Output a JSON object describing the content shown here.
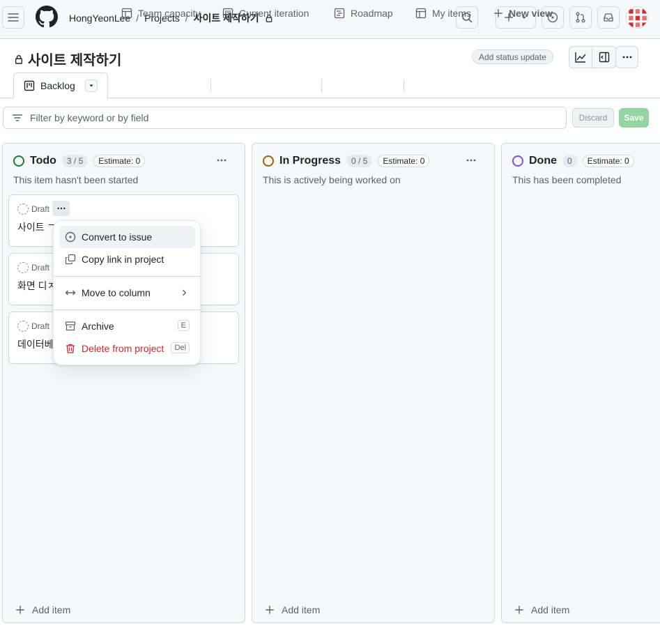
{
  "header": {
    "owner": "HongYeonLee",
    "projects_link": "Projects",
    "current_project": "사이트 제작하기",
    "separator": "/"
  },
  "project": {
    "title": "사이트 제작하기",
    "status_update": "Add status update"
  },
  "tabs": [
    {
      "label": "Backlog",
      "icon": "board-icon",
      "active": true
    },
    {
      "label": "Team capacity",
      "icon": "table-icon"
    },
    {
      "label": "Current iteration",
      "icon": "board-icon"
    },
    {
      "label": "Roadmap",
      "icon": "roadmap-icon"
    },
    {
      "label": "My items",
      "icon": "table-icon"
    },
    {
      "label": "New view",
      "icon": "plus-icon"
    }
  ],
  "filter": {
    "placeholder": "Filter by keyword or by field",
    "discard": "Discard",
    "save": "Save"
  },
  "columns": [
    {
      "title": "Todo",
      "count": "3 / 5",
      "estimate": "Estimate: 0",
      "description": "This item hasn't been started",
      "color": "#1a7f37",
      "add_item": "Add item",
      "cards": [
        {
          "status": "Draft",
          "title": "사이트 ㄱ"
        },
        {
          "status": "Draft",
          "title": "화면 디ㅈ"
        },
        {
          "status": "Draft",
          "title": "데이터베"
        }
      ]
    },
    {
      "title": "In Progress",
      "count": "0 / 5",
      "estimate": "Estimate: 0",
      "description": "This is actively being worked on",
      "color": "#9a6700",
      "add_item": "Add item"
    },
    {
      "title": "Done",
      "count": "0",
      "estimate": "Estimate: 0",
      "description": "This has been completed",
      "color": "#8250df",
      "add_item": "Add item"
    }
  ],
  "context_menu": {
    "convert": "Convert to issue",
    "copy_link": "Copy link in project",
    "move": "Move to column",
    "archive": "Archive",
    "archive_key": "E",
    "delete": "Delete from project",
    "delete_key": "Del"
  },
  "colors": {
    "accent_green": "#1a7f37",
    "danger": "#d1242f",
    "border": "#d1d9e0"
  }
}
